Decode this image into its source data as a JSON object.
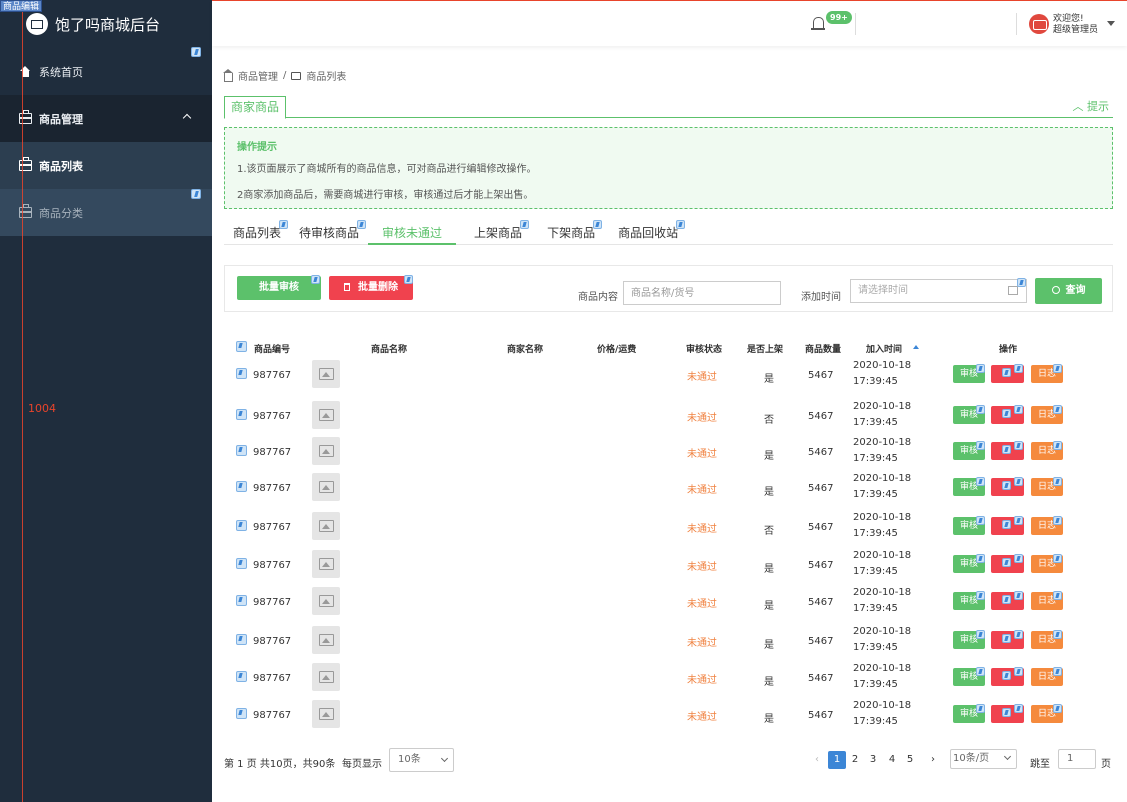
{
  "sidebar": {
    "brand": "饱了吗商城后台",
    "items": [
      {
        "label": "系统首页"
      },
      {
        "label": "商品管理"
      },
      {
        "label": "商品列表"
      },
      {
        "label": "商品分类"
      }
    ]
  },
  "overlay": {
    "tag": "商品编辑",
    "number": "1004"
  },
  "header": {
    "notif_count": "99+",
    "greeting": "欢迎您!",
    "role": "超级管理员"
  },
  "breadcrumb": [
    "商品管理",
    "商品列表"
  ],
  "panel": {
    "title": "商家商品",
    "tip_toggle": "提示"
  },
  "notice": {
    "title": "操作提示",
    "lines": [
      "1.该页面展示了商城所有的商品信息，可对商品进行编辑修改操作。",
      "2商家添加商品后，需要商城进行审核，审核通过后才能上架出售。"
    ]
  },
  "tabs": [
    "商品列表",
    "待审核商品",
    "审核未通过",
    "上架商品",
    "下架商品",
    "商品回收站"
  ],
  "active_tab": "审核未通过",
  "toolbar": {
    "batch_review": "批量审核",
    "batch_delete": "批量删除",
    "content_label": "商品内容",
    "content_placeholder": "商品名称/货号",
    "time_label": "添加时间",
    "time_placeholder": "请选择时间",
    "search": "查询"
  },
  "table": {
    "headers": [
      "商品编号",
      "商品名称",
      "商家名称",
      "价格/运费",
      "审核状态",
      "是否上架",
      "商品数量",
      "加入时间",
      "操作"
    ],
    "rows": [
      {
        "id": "987767",
        "status": "未通过",
        "onsale": "是",
        "qty": "5467",
        "date": "2020-10-18",
        "time": "17:39:45"
      },
      {
        "id": "987767",
        "status": "未通过",
        "onsale": "否",
        "qty": "5467",
        "date": "2020-10-18",
        "time": "17:39:45"
      },
      {
        "id": "987767",
        "status": "未通过",
        "onsale": "是",
        "qty": "5467",
        "date": "2020-10-18",
        "time": "17:39:45"
      },
      {
        "id": "987767",
        "status": "未通过",
        "onsale": "是",
        "qty": "5467",
        "date": "2020-10-18",
        "time": "17:39:45"
      },
      {
        "id": "987767",
        "status": "未通过",
        "onsale": "否",
        "qty": "5467",
        "date": "2020-10-18",
        "time": "17:39:45"
      },
      {
        "id": "987767",
        "status": "未通过",
        "onsale": "是",
        "qty": "5467",
        "date": "2020-10-18",
        "time": "17:39:45"
      },
      {
        "id": "987767",
        "status": "未通过",
        "onsale": "是",
        "qty": "5467",
        "date": "2020-10-18",
        "time": "17:39:45"
      },
      {
        "id": "987767",
        "status": "未通过",
        "onsale": "是",
        "qty": "5467",
        "date": "2020-10-18",
        "time": "17:39:45"
      },
      {
        "id": "987767",
        "status": "未通过",
        "onsale": "是",
        "qty": "5467",
        "date": "2020-10-18",
        "time": "17:39:45"
      },
      {
        "id": "987767",
        "status": "未通过",
        "onsale": "是",
        "qty": "5467",
        "date": "2020-10-18",
        "time": "17:39:45"
      }
    ],
    "actions": {
      "review": "审核",
      "delete": "删除",
      "log": "日志"
    }
  },
  "pagination": {
    "summary": "第 1 页 共10页，共90条",
    "per_page_label": "每页显示",
    "per_page_value": "10条",
    "pages": [
      "1",
      "2",
      "3",
      "4",
      "5"
    ],
    "page_size": "10条/页",
    "goto_label": "跳至",
    "goto_value": "1",
    "page_unit": "页"
  },
  "colors": {
    "accent": "#5cc16b",
    "danger": "#f0424e",
    "warn": "#f58a3d",
    "sidebar": "#1f2d3d"
  }
}
